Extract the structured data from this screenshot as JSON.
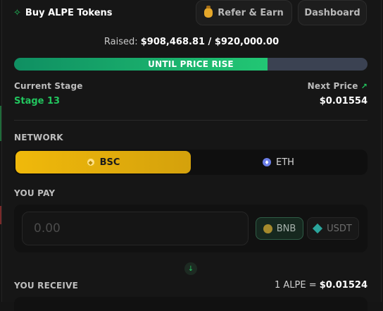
{
  "header": {
    "title": "Buy ALPE Tokens",
    "refer_label": "Refer & Earn",
    "dashboard_label": "Dashboard"
  },
  "raised": {
    "label": "Raised:",
    "value": "$908,468.81 / $920,000.00",
    "progress_fraction": 0.7173
  },
  "progress": {
    "text": "UNTIL PRICE RISE"
  },
  "stage": {
    "label": "Current Stage",
    "value": "Stage 13"
  },
  "next_price": {
    "label": "Next Price",
    "value": "$0.01554"
  },
  "network": {
    "label": "NETWORK",
    "options": [
      {
        "label": "BSC",
        "selected": true
      },
      {
        "label": "ETH",
        "selected": false
      }
    ]
  },
  "pay": {
    "label": "YOU PAY",
    "placeholder": "0.00",
    "tokens": [
      {
        "label": "BNB",
        "selected": true
      },
      {
        "label": "USDT",
        "selected": false
      }
    ]
  },
  "receive": {
    "label": "YOU RECEIVE",
    "rate_prefix": "1 ALPE =",
    "rate_value": "$0.01524"
  },
  "colors": {
    "accent": "#22c55e",
    "bsc": "#f0b90b",
    "background": "#161616"
  }
}
